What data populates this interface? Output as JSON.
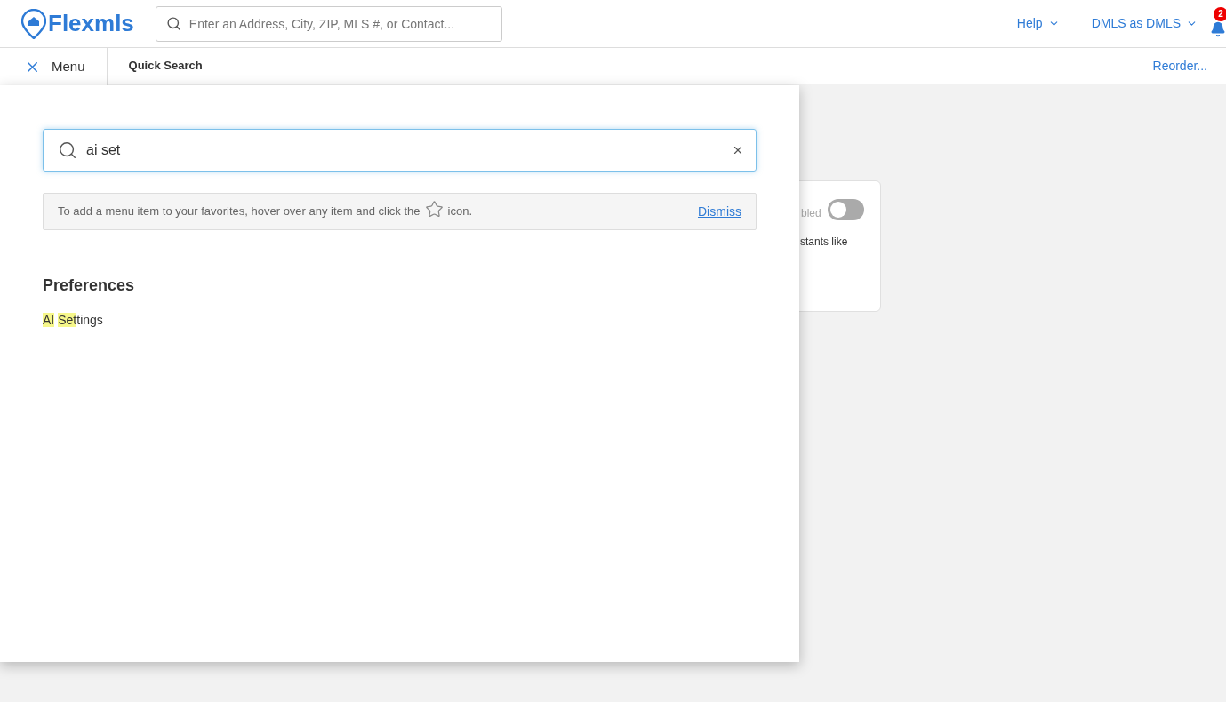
{
  "header": {
    "logo": "Flexmls",
    "search": {
      "placeholder": "Enter an Address, City, ZIP, MLS #, or Contact..."
    },
    "help": "Help",
    "account": "DMLS as DMLS",
    "notifications": "2"
  },
  "tabs": [
    {
      "label": "Menu",
      "kind": "menu",
      "selected": true
    },
    {
      "label": "Quick Search",
      "kind": "tab",
      "selected": false
    }
  ],
  "reorder": "Reorder...",
  "menu": {
    "search": {
      "value": "ai set"
    },
    "tip": {
      "before": "To add a menu item to your favorites, hover over any item and click the",
      "after": "icon.",
      "dismiss": "Dismiss"
    },
    "sections": [
      {
        "title": "Preferences",
        "items": [
          {
            "parts": [
              {
                "text": "AI",
                "highlighted": true
              },
              {
                "text": "Set",
                "highlighted": true,
                "space_before": true
              },
              {
                "text": "tings",
                "highlighted": false
              }
            ]
          }
        ]
      }
    ]
  },
  "background_card": {
    "status": "bled",
    "toggle": {
      "on": false
    },
    "description": "stants like"
  }
}
